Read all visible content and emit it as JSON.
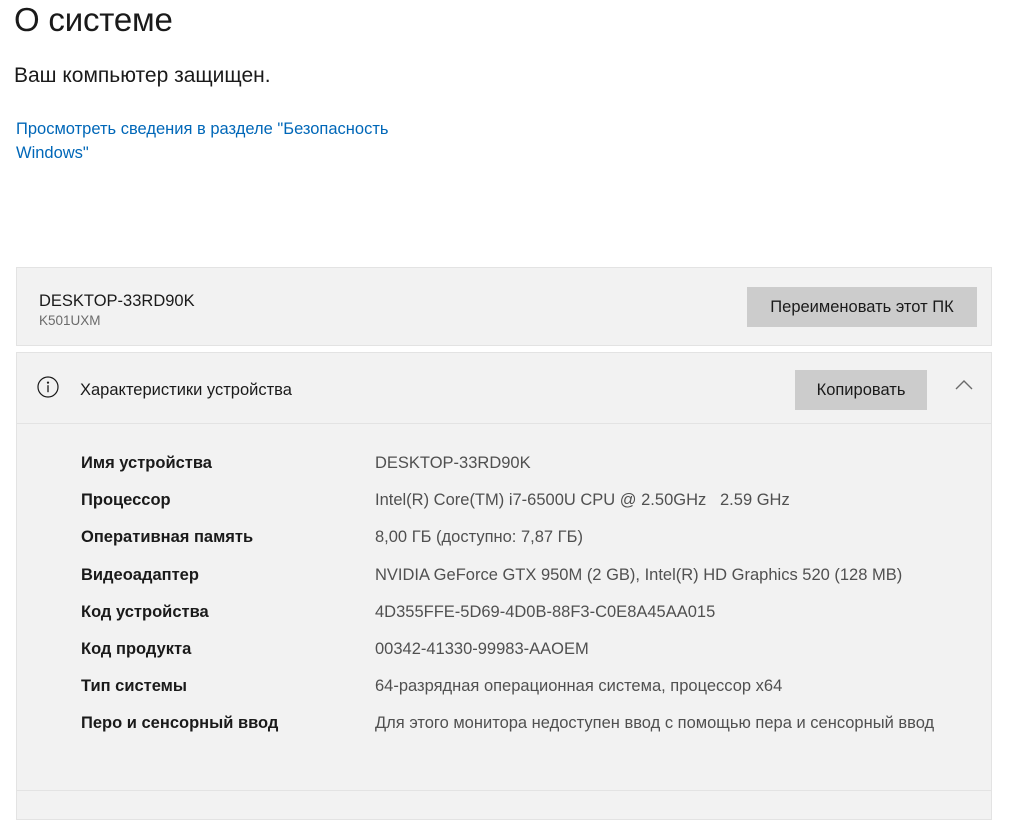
{
  "page": {
    "title": "О системе",
    "protection_status": "Ваш компьютер защищен.",
    "security_link": "Просмотреть сведения в разделе \"Безопасность Windows\""
  },
  "pc": {
    "name": "DESKTOP-33RD90K",
    "model": "K501UXM",
    "rename_button": "Переименовать этот ПК"
  },
  "specs": {
    "title": "Характеристики устройства",
    "copy_button": "Копировать",
    "icon": "info-icon",
    "rows": [
      {
        "label": "Имя устройства",
        "value": "DESKTOP-33RD90K"
      },
      {
        "label": "Процессор",
        "value": "Intel(R) Core(TM) i7-6500U CPU @ 2.50GHz   2.59 GHz"
      },
      {
        "label": "Оперативная память",
        "value": "8,00 ГБ (доступно: 7,87 ГБ)"
      },
      {
        "label": "Видеоадаптер",
        "value": "NVIDIA GeForce GTX 950M (2 GB), Intel(R) HD Graphics 520 (128 MB)"
      },
      {
        "label": "Код устройства",
        "value": "4D355FFE-5D69-4D0B-88F3-C0E8A45AA015"
      },
      {
        "label": "Код продукта",
        "value": "00342-41330-99983-AAOEM"
      },
      {
        "label": "Тип системы",
        "value": "64-разрядная операционная система, процессор x64"
      },
      {
        "label": "Перо и сенсорный ввод",
        "value": "Для этого монитора недоступен ввод с помощью пера и сенсорный ввод"
      }
    ]
  },
  "colors": {
    "accent_link": "#0067b8",
    "card_background": "#f2f2f2",
    "button_background": "#cccccc"
  }
}
